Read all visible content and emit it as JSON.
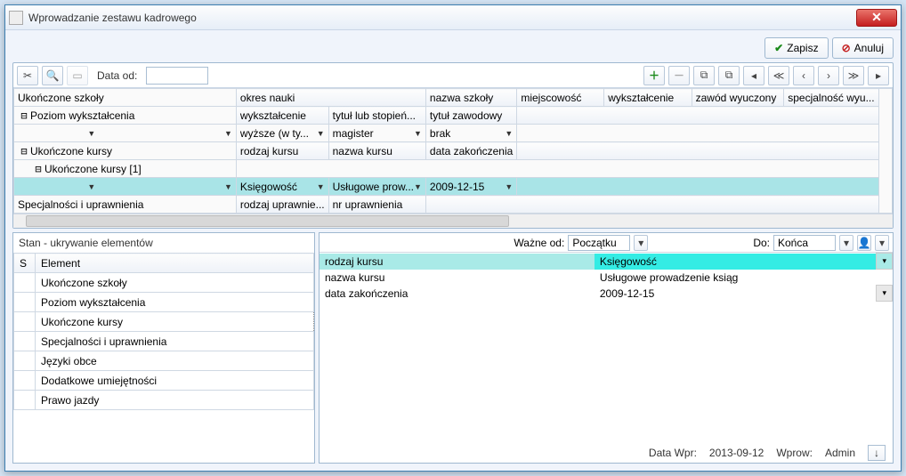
{
  "window": {
    "title": "Wprowadzanie zestawu kadrowego"
  },
  "buttons": {
    "save": "Zapisz",
    "cancel": "Anuluj"
  },
  "toolbar": {
    "date_from_label": "Data od:",
    "date_from_value": ""
  },
  "tree": {
    "row0": {
      "label": "Ukończone szkoły",
      "c1": "okres nauki",
      "c2": "",
      "c3": "nazwa szkoły",
      "c4": "miejscowość",
      "c5": "wykształcenie",
      "c6": "zawód wyuczony",
      "c7": "specjalność wyu..."
    },
    "row1": {
      "label": "Poziom wykształcenia",
      "c1": "wykształcenie",
      "c2": "tytuł lub stopień...",
      "c3": "tytuł zawodowy"
    },
    "row2": {
      "c1": "wyższe (w ty...",
      "c2": "magister",
      "c3": "brak"
    },
    "row3": {
      "label": "Ukończone kursy",
      "c1": "rodzaj kursu",
      "c2": "nazwa kursu",
      "c3": "data zakończenia"
    },
    "row4": {
      "label": "Ukończone kursy [1]"
    },
    "row5": {
      "c1": "Księgowość",
      "c2": "Usługowe prow...",
      "c3": "2009-12-15"
    },
    "row6": {
      "label": "Specjalności i uprawnienia",
      "c1": "rodzaj uprawnie...",
      "c2": "nr uprawnienia"
    }
  },
  "state": {
    "header": "Stan - ukrywanie elementów",
    "col_s": "S",
    "col_el": "Element",
    "items": [
      "Ukończone szkoły",
      "Poziom wykształcenia",
      "Ukończone kursy",
      "Specjalności i uprawnienia",
      "Języki obce",
      "Dodatkowe umiejętności",
      "Prawo jazdy"
    ]
  },
  "valid": {
    "from_label": "Ważne od:",
    "from_value": "Początku",
    "to_label": "Do:",
    "to_value": "Końca"
  },
  "detail": {
    "r0": {
      "k": "rodzaj kursu",
      "v": "Księgowość"
    },
    "r1": {
      "k": "nazwa kursu",
      "v": "Usługowe prowadzenie ksiąg"
    },
    "r2": {
      "k": "data zakończenia",
      "v": "2009-12-15"
    }
  },
  "footer": {
    "datewpr_label": "Data Wpr:",
    "datewpr_value": "2013-09-12",
    "wprow_label": "Wprow:",
    "wprow_value": "Admin"
  }
}
